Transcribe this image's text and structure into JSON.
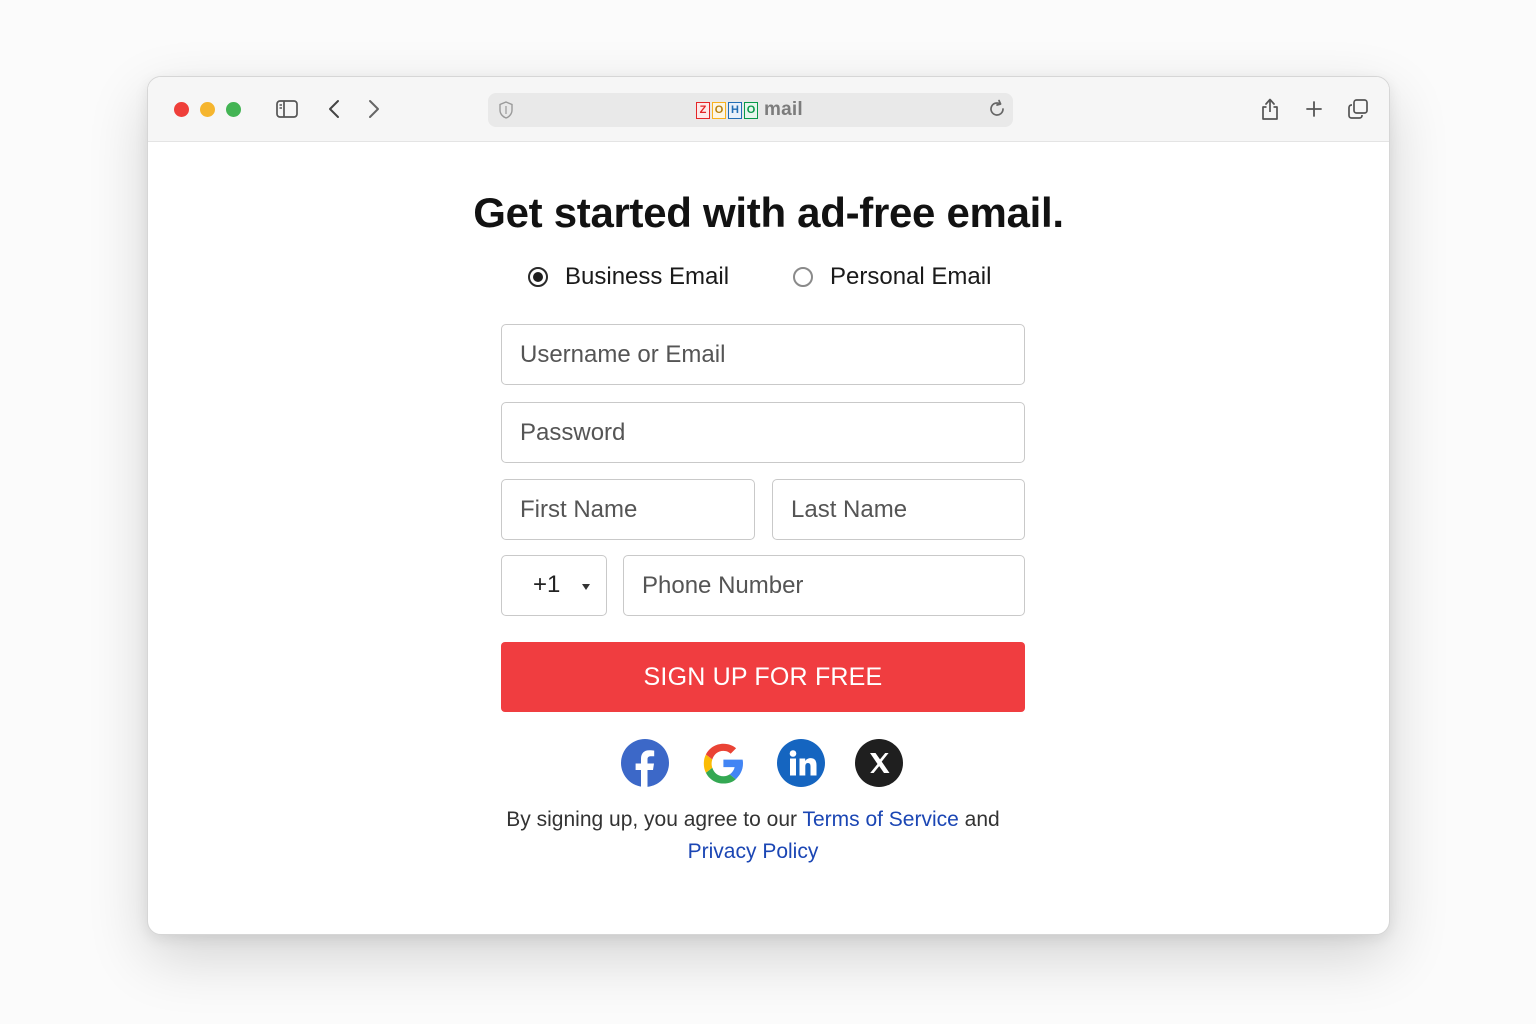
{
  "browser": {
    "brand_logo_letters": [
      "Z",
      "O",
      "H",
      "O"
    ],
    "brand_logo_colors": [
      "#e42527",
      "#f9b21d",
      "#226db4",
      "#089949"
    ],
    "brand_text": "mail",
    "icons": [
      "sidebar-icon",
      "back-icon",
      "forward-icon",
      "shield-icon",
      "reload-icon",
      "share-icon",
      "new-tab-icon",
      "tabs-overview-icon"
    ]
  },
  "page": {
    "headline": "Get started with ad-free email.",
    "account_type": {
      "options": [
        {
          "label": "Business Email",
          "selected": true
        },
        {
          "label": "Personal Email",
          "selected": false
        }
      ]
    },
    "form": {
      "username_placeholder": "Username or Email",
      "password_placeholder": "Password",
      "first_name_placeholder": "First Name",
      "last_name_placeholder": "Last Name",
      "country_code": "+1",
      "phone_placeholder": "Phone Number",
      "submit_label": "SIGN UP FOR FREE",
      "submit_color": "#f03d40"
    },
    "social": [
      "facebook-icon",
      "google-icon",
      "linkedin-icon",
      "x-icon"
    ],
    "terms": {
      "prefix": "By signing up, you agree to our ",
      "tos_link": "Terms of Service",
      "middle": " and",
      "privacy_link": "Privacy Policy",
      "link_color": "#1b46b4"
    }
  }
}
